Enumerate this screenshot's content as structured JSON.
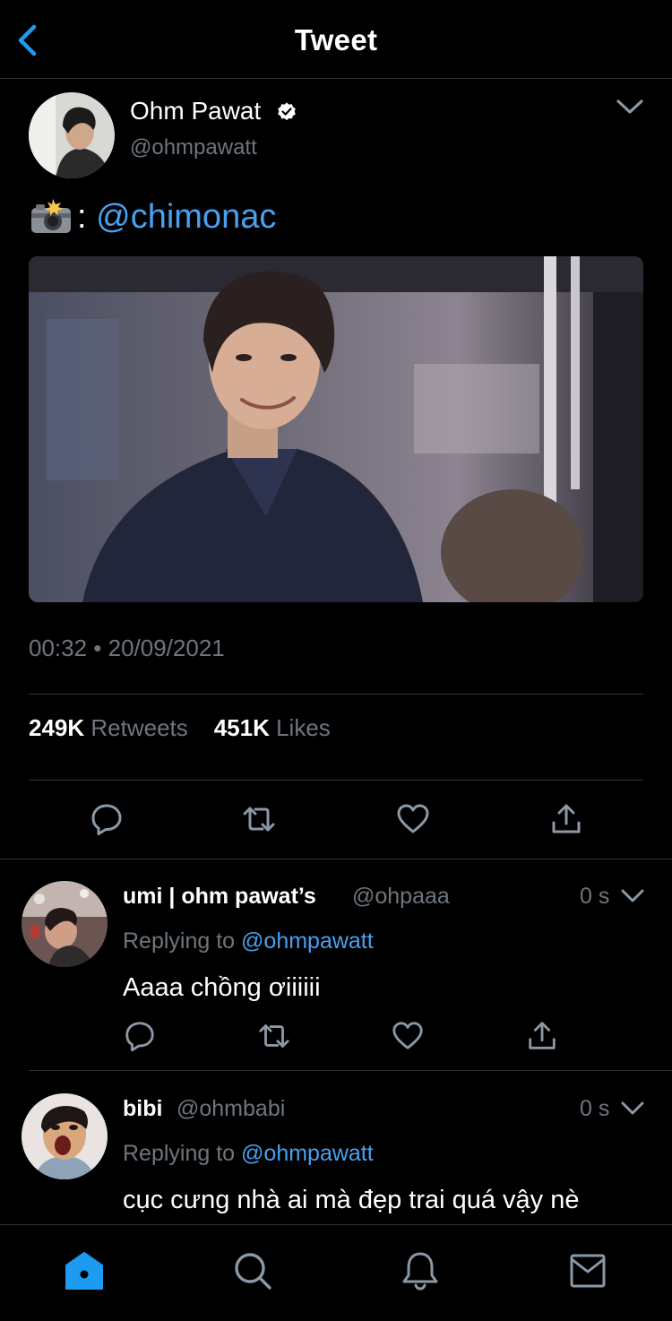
{
  "header": {
    "title": "Tweet",
    "back_icon": "chevron-left-icon"
  },
  "tweet": {
    "author_name": "Ohm Pawat",
    "author_handle": "@ohmpawatt",
    "verified_icon": "verified-badge-icon",
    "text_suffix": ":",
    "mention": "@chimonac",
    "time": "00:32 • 20/09/2021",
    "retweets_count": "249K",
    "retweets_label": "Retweets",
    "likes_count": "451K",
    "likes_label": "Likes"
  },
  "replies": [
    {
      "name": "umi | ohm pawat’s",
      "handle": "@ohpaaa",
      "time": "0 s",
      "replying_label": "Replying to",
      "replying_to": "@ohmpawatt",
      "text": "Aaaa chồng ơiiiiii"
    },
    {
      "name": "bibi",
      "handle": "@ohmbabi",
      "time": "0 s",
      "replying_label": "Replying to",
      "replying_to": "@ohmpawatt",
      "text": "cục cưng nhà ai mà đẹp trai quá vậy nè"
    }
  ],
  "tabbar": {
    "items": [
      "home-icon",
      "search-icon",
      "notifications-icon",
      "messages-icon"
    ],
    "active": "home-icon"
  },
  "colors": {
    "background": "#000000",
    "accent": "#1d9bf0",
    "link": "#4aa0f0",
    "secondary_text": "#6e767d",
    "divider": "#2f3336"
  }
}
